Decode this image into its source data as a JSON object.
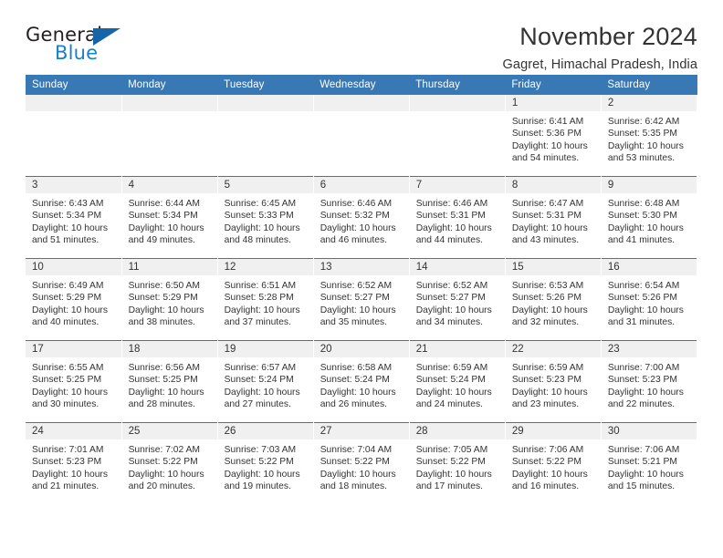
{
  "brand": {
    "name_part1": "General",
    "name_part2": "Blue",
    "triangle_color": "#1565a8",
    "blue_color": "#1b7fc4"
  },
  "header": {
    "title": "November 2024",
    "subtitle": "Gagret, Himachal Pradesh, India"
  },
  "theme": {
    "header_blue": "#3878b4",
    "daynum_band_gray": "#f0f0f0",
    "text_color": "#333333"
  },
  "weekday_headers": [
    "Sunday",
    "Monday",
    "Tuesday",
    "Wednesday",
    "Thursday",
    "Friday",
    "Saturday"
  ],
  "weeks": [
    [
      {
        "day": "",
        "empty": true
      },
      {
        "day": "",
        "empty": true
      },
      {
        "day": "",
        "empty": true
      },
      {
        "day": "",
        "empty": true
      },
      {
        "day": "",
        "empty": true
      },
      {
        "day": "1",
        "sunrise": "Sunrise: 6:41 AM",
        "sunset": "Sunset: 5:36 PM",
        "daylight": "Daylight: 10 hours and 54 minutes."
      },
      {
        "day": "2",
        "sunrise": "Sunrise: 6:42 AM",
        "sunset": "Sunset: 5:35 PM",
        "daylight": "Daylight: 10 hours and 53 minutes."
      }
    ],
    [
      {
        "day": "3",
        "sunrise": "Sunrise: 6:43 AM",
        "sunset": "Sunset: 5:34 PM",
        "daylight": "Daylight: 10 hours and 51 minutes."
      },
      {
        "day": "4",
        "sunrise": "Sunrise: 6:44 AM",
        "sunset": "Sunset: 5:34 PM",
        "daylight": "Daylight: 10 hours and 49 minutes."
      },
      {
        "day": "5",
        "sunrise": "Sunrise: 6:45 AM",
        "sunset": "Sunset: 5:33 PM",
        "daylight": "Daylight: 10 hours and 48 minutes."
      },
      {
        "day": "6",
        "sunrise": "Sunrise: 6:46 AM",
        "sunset": "Sunset: 5:32 PM",
        "daylight": "Daylight: 10 hours and 46 minutes."
      },
      {
        "day": "7",
        "sunrise": "Sunrise: 6:46 AM",
        "sunset": "Sunset: 5:31 PM",
        "daylight": "Daylight: 10 hours and 44 minutes."
      },
      {
        "day": "8",
        "sunrise": "Sunrise: 6:47 AM",
        "sunset": "Sunset: 5:31 PM",
        "daylight": "Daylight: 10 hours and 43 minutes."
      },
      {
        "day": "9",
        "sunrise": "Sunrise: 6:48 AM",
        "sunset": "Sunset: 5:30 PM",
        "daylight": "Daylight: 10 hours and 41 minutes."
      }
    ],
    [
      {
        "day": "10",
        "sunrise": "Sunrise: 6:49 AM",
        "sunset": "Sunset: 5:29 PM",
        "daylight": "Daylight: 10 hours and 40 minutes."
      },
      {
        "day": "11",
        "sunrise": "Sunrise: 6:50 AM",
        "sunset": "Sunset: 5:29 PM",
        "daylight": "Daylight: 10 hours and 38 minutes."
      },
      {
        "day": "12",
        "sunrise": "Sunrise: 6:51 AM",
        "sunset": "Sunset: 5:28 PM",
        "daylight": "Daylight: 10 hours and 37 minutes."
      },
      {
        "day": "13",
        "sunrise": "Sunrise: 6:52 AM",
        "sunset": "Sunset: 5:27 PM",
        "daylight": "Daylight: 10 hours and 35 minutes."
      },
      {
        "day": "14",
        "sunrise": "Sunrise: 6:52 AM",
        "sunset": "Sunset: 5:27 PM",
        "daylight": "Daylight: 10 hours and 34 minutes."
      },
      {
        "day": "15",
        "sunrise": "Sunrise: 6:53 AM",
        "sunset": "Sunset: 5:26 PM",
        "daylight": "Daylight: 10 hours and 32 minutes."
      },
      {
        "day": "16",
        "sunrise": "Sunrise: 6:54 AM",
        "sunset": "Sunset: 5:26 PM",
        "daylight": "Daylight: 10 hours and 31 minutes."
      }
    ],
    [
      {
        "day": "17",
        "sunrise": "Sunrise: 6:55 AM",
        "sunset": "Sunset: 5:25 PM",
        "daylight": "Daylight: 10 hours and 30 minutes."
      },
      {
        "day": "18",
        "sunrise": "Sunrise: 6:56 AM",
        "sunset": "Sunset: 5:25 PM",
        "daylight": "Daylight: 10 hours and 28 minutes."
      },
      {
        "day": "19",
        "sunrise": "Sunrise: 6:57 AM",
        "sunset": "Sunset: 5:24 PM",
        "daylight": "Daylight: 10 hours and 27 minutes."
      },
      {
        "day": "20",
        "sunrise": "Sunrise: 6:58 AM",
        "sunset": "Sunset: 5:24 PM",
        "daylight": "Daylight: 10 hours and 26 minutes."
      },
      {
        "day": "21",
        "sunrise": "Sunrise: 6:59 AM",
        "sunset": "Sunset: 5:24 PM",
        "daylight": "Daylight: 10 hours and 24 minutes."
      },
      {
        "day": "22",
        "sunrise": "Sunrise: 6:59 AM",
        "sunset": "Sunset: 5:23 PM",
        "daylight": "Daylight: 10 hours and 23 minutes."
      },
      {
        "day": "23",
        "sunrise": "Sunrise: 7:00 AM",
        "sunset": "Sunset: 5:23 PM",
        "daylight": "Daylight: 10 hours and 22 minutes."
      }
    ],
    [
      {
        "day": "24",
        "sunrise": "Sunrise: 7:01 AM",
        "sunset": "Sunset: 5:23 PM",
        "daylight": "Daylight: 10 hours and 21 minutes."
      },
      {
        "day": "25",
        "sunrise": "Sunrise: 7:02 AM",
        "sunset": "Sunset: 5:22 PM",
        "daylight": "Daylight: 10 hours and 20 minutes."
      },
      {
        "day": "26",
        "sunrise": "Sunrise: 7:03 AM",
        "sunset": "Sunset: 5:22 PM",
        "daylight": "Daylight: 10 hours and 19 minutes."
      },
      {
        "day": "27",
        "sunrise": "Sunrise: 7:04 AM",
        "sunset": "Sunset: 5:22 PM",
        "daylight": "Daylight: 10 hours and 18 minutes."
      },
      {
        "day": "28",
        "sunrise": "Sunrise: 7:05 AM",
        "sunset": "Sunset: 5:22 PM",
        "daylight": "Daylight: 10 hours and 17 minutes."
      },
      {
        "day": "29",
        "sunrise": "Sunrise: 7:06 AM",
        "sunset": "Sunset: 5:22 PM",
        "daylight": "Daylight: 10 hours and 16 minutes."
      },
      {
        "day": "30",
        "sunrise": "Sunrise: 7:06 AM",
        "sunset": "Sunset: 5:21 PM",
        "daylight": "Daylight: 10 hours and 15 minutes."
      }
    ]
  ]
}
